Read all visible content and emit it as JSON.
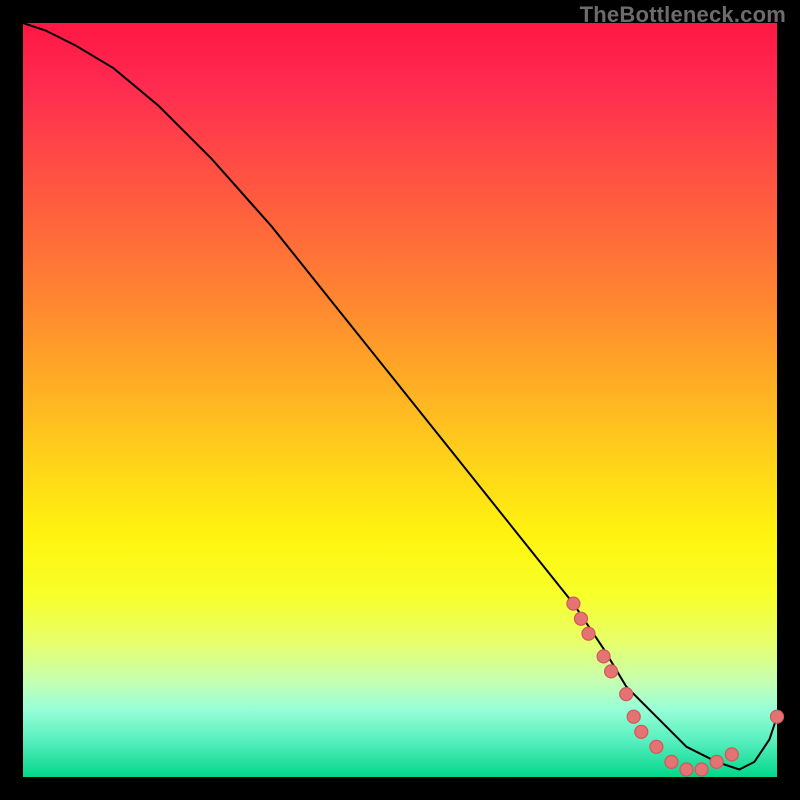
{
  "watermark": "TheBottleneck.com",
  "chart_data": {
    "type": "line",
    "title": "",
    "xlabel": "",
    "ylabel": "",
    "xlim": [
      0,
      100
    ],
    "ylim": [
      0,
      100
    ],
    "legend": false,
    "grid": false,
    "background": "heatmap-red-to-green-vertical",
    "series": [
      {
        "name": "bottleneck-curve",
        "x": [
          0,
          3,
          7,
          12,
          18,
          25,
          33,
          41,
          49,
          57,
          65,
          73,
          77,
          80,
          84,
          88,
          92,
          95,
          97,
          99,
          100
        ],
        "y": [
          100,
          99,
          97,
          94,
          89,
          82,
          73,
          63,
          53,
          43,
          33,
          23,
          17,
          12,
          8,
          4,
          2,
          1,
          2,
          5,
          8
        ]
      }
    ],
    "markers": {
      "name": "highlighted-points",
      "style": "circle",
      "color": "#e57373",
      "points": [
        {
          "x": 73,
          "y": 23
        },
        {
          "x": 74,
          "y": 21
        },
        {
          "x": 75,
          "y": 19
        },
        {
          "x": 77,
          "y": 16
        },
        {
          "x": 78,
          "y": 14
        },
        {
          "x": 80,
          "y": 11
        },
        {
          "x": 81,
          "y": 8
        },
        {
          "x": 82,
          "y": 6
        },
        {
          "x": 84,
          "y": 4
        },
        {
          "x": 86,
          "y": 2
        },
        {
          "x": 88,
          "y": 1
        },
        {
          "x": 90,
          "y": 1
        },
        {
          "x": 92,
          "y": 2
        },
        {
          "x": 94,
          "y": 3
        },
        {
          "x": 100,
          "y": 8
        }
      ]
    },
    "cluster_label": ""
  }
}
